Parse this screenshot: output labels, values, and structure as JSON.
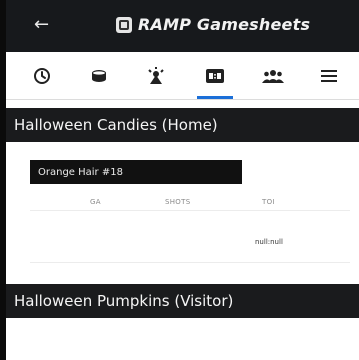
{
  "appbar": {
    "back_icon": "arrow-left-icon",
    "logo_icon": "ramp-logo-icon",
    "title": "RAMP Gamesheets"
  },
  "tabs": [
    {
      "icon": "clock-icon",
      "active": false
    },
    {
      "icon": "puck-icon",
      "active": false
    },
    {
      "icon": "goal-light-icon",
      "active": false
    },
    {
      "icon": "scoreboard-icon",
      "active": true
    },
    {
      "icon": "team-icon",
      "active": false
    },
    {
      "icon": "menu-icon",
      "active": false
    }
  ],
  "home_section": {
    "title": "Halloween Candies (Home)",
    "player": "Orange Hair #18",
    "columns": {
      "ga": "GA",
      "shots": "SHOTS",
      "toi": "TOI"
    },
    "toi_value": "null:null"
  },
  "visitor_section": {
    "title": "Halloween Pumpkins (Visitor)"
  },
  "colors": {
    "bar": "#17191c",
    "accent": "#1b6fd8"
  }
}
